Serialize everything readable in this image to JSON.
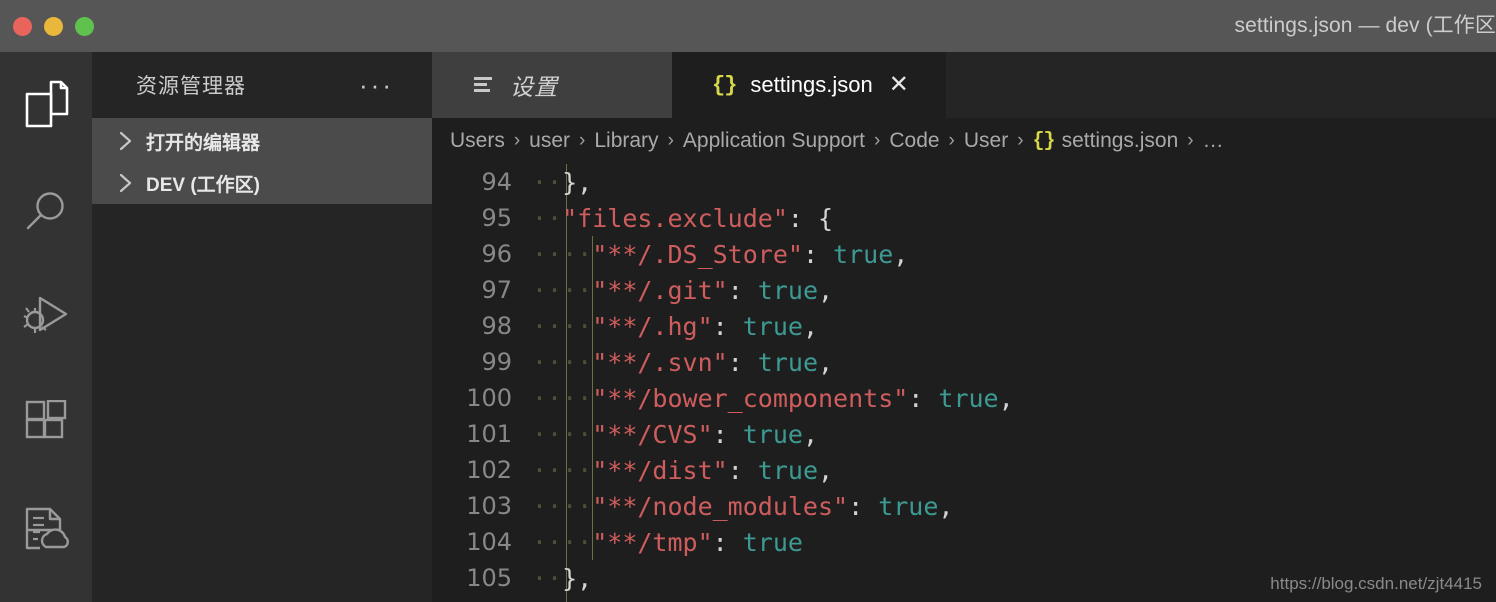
{
  "window": {
    "title": "settings.json — dev (工作区",
    "traffic_lights": [
      {
        "name": "close",
        "color": "#e9655b"
      },
      {
        "name": "minimize",
        "color": "#e8b73c"
      },
      {
        "name": "maximize",
        "color": "#5fc24f"
      }
    ]
  },
  "activity_bar": {
    "items": [
      {
        "icon": "files-explorer-icon",
        "label": "资源管理器",
        "active": true
      },
      {
        "icon": "search-icon",
        "label": "搜索",
        "active": false
      },
      {
        "icon": "run-debug-icon",
        "label": "运行和调试",
        "active": false
      },
      {
        "icon": "extensions-icon",
        "label": "扩展",
        "active": false
      },
      {
        "icon": "settings-sync-icon",
        "label": "设置同步",
        "active": false
      }
    ]
  },
  "sidebar": {
    "title": "资源管理器",
    "more_actions": "···",
    "tree": [
      {
        "label": "打开的编辑器",
        "expanded": false
      },
      {
        "label": "DEV (工作区)",
        "expanded": false
      }
    ]
  },
  "tabs": [
    {
      "label": "设置",
      "icon": "settings-lines-icon",
      "active": false,
      "preview": true
    },
    {
      "label": "settings.json",
      "icon": "json-braces-icon",
      "active": true,
      "close": "✕"
    }
  ],
  "breadcrumb": {
    "separator": "›",
    "items": [
      "Users",
      "user",
      "Library",
      "Application Support",
      "Code",
      "User"
    ],
    "file": "settings.json",
    "file_icon": "{}",
    "overflow": "…"
  },
  "editor": {
    "first_line": 94,
    "lines": [
      {
        "n": "94",
        "indent_dots": 2,
        "tokens": [
          {
            "t": "},",
            "c": "punc"
          }
        ]
      },
      {
        "n": "95",
        "indent_dots": 2,
        "tokens": [
          {
            "t": "\"files.exclude\"",
            "c": "str"
          },
          {
            "t": ": {",
            "c": "punc"
          }
        ]
      },
      {
        "n": "96",
        "indent_dots": 4,
        "tokens": [
          {
            "t": "\"**/.DS_Store\"",
            "c": "str"
          },
          {
            "t": ": ",
            "c": "punc"
          },
          {
            "t": "true",
            "c": "bool"
          },
          {
            "t": ",",
            "c": "punc"
          }
        ]
      },
      {
        "n": "97",
        "indent_dots": 4,
        "tokens": [
          {
            "t": "\"**/.git\"",
            "c": "str"
          },
          {
            "t": ": ",
            "c": "punc"
          },
          {
            "t": "true",
            "c": "bool"
          },
          {
            "t": ",",
            "c": "punc"
          }
        ]
      },
      {
        "n": "98",
        "indent_dots": 4,
        "tokens": [
          {
            "t": "\"**/.hg\"",
            "c": "str"
          },
          {
            "t": ": ",
            "c": "punc"
          },
          {
            "t": "true",
            "c": "bool"
          },
          {
            "t": ",",
            "c": "punc"
          }
        ]
      },
      {
        "n": "99",
        "indent_dots": 4,
        "tokens": [
          {
            "t": "\"**/.svn\"",
            "c": "str"
          },
          {
            "t": ": ",
            "c": "punc"
          },
          {
            "t": "true",
            "c": "bool"
          },
          {
            "t": ",",
            "c": "punc"
          }
        ]
      },
      {
        "n": "100",
        "indent_dots": 4,
        "tokens": [
          {
            "t": "\"**/bower_components\"",
            "c": "str"
          },
          {
            "t": ": ",
            "c": "punc"
          },
          {
            "t": "true",
            "c": "bool"
          },
          {
            "t": ",",
            "c": "punc"
          }
        ]
      },
      {
        "n": "101",
        "indent_dots": 4,
        "tokens": [
          {
            "t": "\"**/CVS\"",
            "c": "str"
          },
          {
            "t": ": ",
            "c": "punc"
          },
          {
            "t": "true",
            "c": "bool"
          },
          {
            "t": ",",
            "c": "punc"
          }
        ]
      },
      {
        "n": "102",
        "indent_dots": 4,
        "tokens": [
          {
            "t": "\"**/dist\"",
            "c": "str"
          },
          {
            "t": ": ",
            "c": "punc"
          },
          {
            "t": "true",
            "c": "bool"
          },
          {
            "t": ",",
            "c": "punc"
          }
        ]
      },
      {
        "n": "103",
        "indent_dots": 4,
        "tokens": [
          {
            "t": "\"**/node_modules\"",
            "c": "str"
          },
          {
            "t": ": ",
            "c": "punc"
          },
          {
            "t": "true",
            "c": "bool"
          },
          {
            "t": ",",
            "c": "punc"
          }
        ]
      },
      {
        "n": "104",
        "indent_dots": 4,
        "tokens": [
          {
            "t": "\"**/tmp\"",
            "c": "str"
          },
          {
            "t": ": ",
            "c": "punc"
          },
          {
            "t": "true",
            "c": "bool"
          }
        ]
      },
      {
        "n": "105",
        "indent_dots": 2,
        "tokens": [
          {
            "t": "},",
            "c": "punc"
          }
        ]
      }
    ]
  },
  "watermark": "https://blog.csdn.net/zjt4415",
  "colors": {
    "titlebar_bg": "#565656",
    "activitybar_bg": "#333333",
    "sidebar_bg": "#252526",
    "tree_selected_bg": "#4b4b4b",
    "editor_bg": "#1e1e1e",
    "tab_inactive_bg": "#3f3f3f",
    "string": "#cf5d5d",
    "boolean": "#3d9a93",
    "line_number": "#888888",
    "indent_guide": "#6f6f45",
    "json_brace": "#d7d74a"
  }
}
